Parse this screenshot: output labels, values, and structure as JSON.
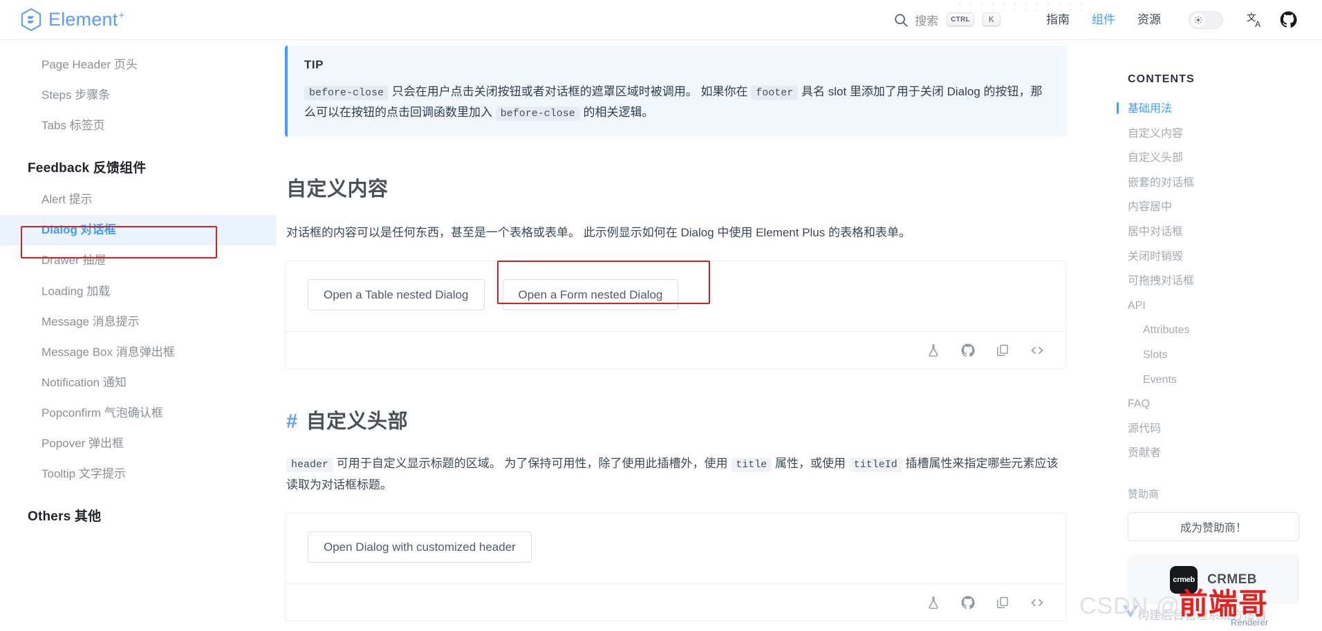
{
  "header": {
    "brand": {
      "name": "Element",
      "plus": "+",
      "icon": "element-logo-icon"
    },
    "search": {
      "label": "搜索",
      "kbd_ctrl": "CTRL",
      "kbd_key": "K",
      "icon": "search-icon"
    },
    "nav": [
      {
        "label": "指南",
        "active": false
      },
      {
        "label": "组件",
        "active": true
      },
      {
        "label": "资源",
        "active": false
      }
    ],
    "theme_toggle_icon": "sun-icon",
    "language_icon": "translate-icon",
    "github_icon": "github-icon"
  },
  "sidebar": {
    "items": [
      {
        "label": "Page Header 页头",
        "type": "link",
        "active": false
      },
      {
        "label": "Steps 步骤条",
        "type": "link",
        "active": false
      },
      {
        "label": "Tabs 标签页",
        "type": "link",
        "active": false
      },
      {
        "label": "Feedback 反馈组件",
        "type": "group"
      },
      {
        "label": "Alert 提示",
        "type": "link",
        "active": false
      },
      {
        "label": "Dialog 对话框",
        "type": "link",
        "active": true
      },
      {
        "label": "Drawer 抽屉",
        "type": "link",
        "active": false
      },
      {
        "label": "Loading 加载",
        "type": "link",
        "active": false
      },
      {
        "label": "Message 消息提示",
        "type": "link",
        "active": false
      },
      {
        "label": "Message Box 消息弹出框",
        "type": "link",
        "active": false
      },
      {
        "label": "Notification 通知",
        "type": "link",
        "active": false
      },
      {
        "label": "Popconfirm 气泡确认框",
        "type": "link",
        "active": false
      },
      {
        "label": "Popover 弹出框",
        "type": "link",
        "active": false
      },
      {
        "label": "Tooltip 文字提示",
        "type": "link",
        "active": false
      },
      {
        "label": "Others 其他",
        "type": "group"
      }
    ]
  },
  "main": {
    "tip": {
      "title": "TIP",
      "code1": "before-close",
      "text1": "只会在用户点击关闭按钮或者对话框的遮罩区域时被调用。 如果你在",
      "code2": "footer",
      "text2": "具名 slot 里添加了用于关闭 Dialog 的按钮，那么可以在按钮的点击回调函数里加入",
      "code3": "before-close",
      "text3": "的相关逻辑。"
    },
    "section_custom_content": {
      "heading": "自定义内容",
      "paragraph": "对话框的内容可以是任何东西，甚至是一个表格或表单。 此示例显示如何在 Dialog 中使用 Element Plus 的表格和表单。",
      "buttons": [
        {
          "label": "Open a Table nested Dialog"
        },
        {
          "label": "Open a Form nested Dialog"
        }
      ]
    },
    "section_custom_header": {
      "hash": "#",
      "heading": "自定义头部",
      "code1": "header",
      "text1": "可用于自定义显示标题的区域。 为了保持可用性，除了使用此插槽外，使用",
      "code2": "title",
      "text2": "属性，或使用",
      "code3": "titleId",
      "text3": "插槽属性来指定哪些元素应该读取为对话框标题。",
      "buttons": [
        {
          "label": "Open Dialog with customized header"
        }
      ]
    },
    "demo_toolbar": [
      {
        "icon": "playground-flask-icon"
      },
      {
        "icon": "github-icon"
      },
      {
        "icon": "copy-icon"
      },
      {
        "icon": "code-brackets-icon"
      }
    ]
  },
  "toc": {
    "title": "CONTENTS",
    "items": [
      {
        "label": "基础用法",
        "active": true,
        "sub": false
      },
      {
        "label": "自定义内容",
        "active": false,
        "sub": false
      },
      {
        "label": "自定义头部",
        "active": false,
        "sub": false
      },
      {
        "label": "嵌套的对话框",
        "active": false,
        "sub": false
      },
      {
        "label": "内容居中",
        "active": false,
        "sub": false
      },
      {
        "label": "居中对话框",
        "active": false,
        "sub": false
      },
      {
        "label": "关闭时销毁",
        "active": false,
        "sub": false
      },
      {
        "label": "可拖拽对话框",
        "active": false,
        "sub": false
      },
      {
        "label": "API",
        "active": false,
        "sub": false
      },
      {
        "label": "Attributes",
        "active": false,
        "sub": true
      },
      {
        "label": "Slots",
        "active": false,
        "sub": true
      },
      {
        "label": "Events",
        "active": false,
        "sub": true
      },
      {
        "label": "FAQ",
        "active": false,
        "sub": false
      },
      {
        "label": "源代码",
        "active": false,
        "sub": false
      },
      {
        "label": "贡献者",
        "active": false,
        "sub": false
      }
    ],
    "sponsor_label": "赞助商",
    "sponsor_button": "成为赞助商！",
    "sponsor_card": {
      "logo_text": "crmeb",
      "name": "CRMEB"
    }
  },
  "watermarks": {
    "csdn": "CSDN @",
    "red": "前端哥",
    "gray": "构建后台管理系统方法自",
    "renderer": "Renderer"
  },
  "colors": {
    "accent": "#409eff",
    "annotation": "#d32020",
    "tip_bg": "#f3f8ff",
    "watermark_red": "#e8201d"
  }
}
